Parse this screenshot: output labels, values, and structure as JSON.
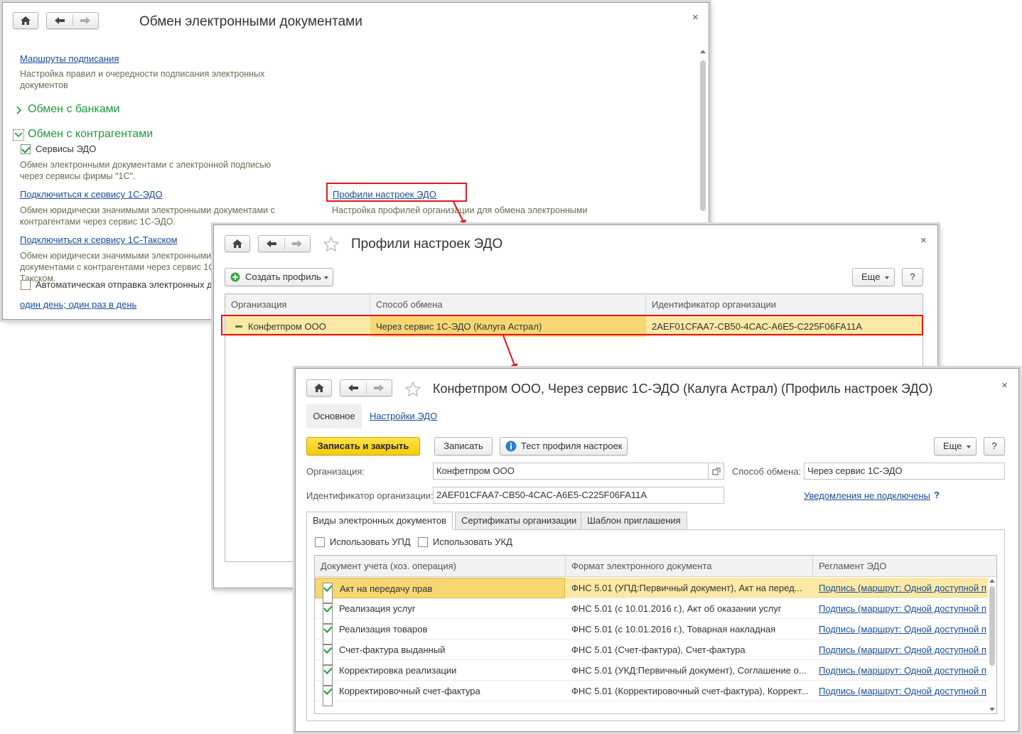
{
  "win1": {
    "title": "Обмен электронными документами",
    "close": "×",
    "routes_link": "Маршруты подписания",
    "routes_note": "Настройка правил и очередности подписания электронных документов",
    "banks_group": "Обмен с банками",
    "contractors_group": "Обмен с контрагентами",
    "edo_services_label": "Сервисы ЭДО",
    "edo_services_note": "Обмен электронными документами с электронной подписью через сервисы фирмы \"1С\".",
    "connect_1c_edo_link": "Подключиться к сервису 1С-ЭДО",
    "connect_1c_edo_note": "Обмен юридически значимыми электронными документами с контрагентами через сервис 1С-ЭДО.",
    "profiles_link": "Профили настроек ЭДО",
    "profiles_note": "Настройка профилей организации для обмена электронными",
    "connect_taxcom_link": "Подключиться к сервису 1С-Такском",
    "connect_taxcom_note": "Обмен юридически значимыми электронными документами с контрагентами через сервис 1С-Такском.",
    "auto_send_label": "Автоматическая отправка электронных до",
    "schedule_link": "один день; один раз в день"
  },
  "win2": {
    "title": "Профили настроек ЭДО",
    "close": "×",
    "create_button": "Создать профиль",
    "more_button": "Еще",
    "help_button": "?",
    "columns": [
      "Организация",
      "Способ обмена",
      "Идентификатор организации"
    ],
    "rows": [
      [
        "Конфетпром ООО",
        "Через сервис 1С-ЭДО (Калуга Астрал)",
        "2AEF01CFAA7-CB50-4CAC-A6E5-C225F06FA11A"
      ]
    ]
  },
  "win3": {
    "title": "Конфетпром ООО, Через сервис 1С-ЭДО (Калуга Астрал) (Профиль настроек ЭДО)",
    "close": "×",
    "tab_main": "Основное",
    "tab_settings_link": "Настройки ЭДО",
    "save_close_button": "Записать и закрыть",
    "save_button": "Записать",
    "test_button": "Тест профиля настроек",
    "more_button": "Еще",
    "help_button": "?",
    "org_label": "Организация:",
    "org_value": "Конфетпром ООО",
    "method_label": "Способ обмена:",
    "method_value": "Через сервис 1С-ЭДО",
    "id_label": "Идентификатор организации:",
    "id_value": "2AEF01CFAA7-CB50-4CAC-A6E5-C225F06FA11A",
    "notifications_link": "Уведомления не подключены",
    "notifications_help": "?",
    "tabs": [
      "Виды электронных документов",
      "Сертификаты организации",
      "Шаблон приглашения"
    ],
    "use_upd": "Использовать УПД",
    "use_ukd": "Использовать УКД",
    "columns": [
      "Документ учета (хоз. операция)",
      "Формат электронного документа",
      "Регламент ЭДО"
    ],
    "rows": [
      {
        "doc": "Акт на передачу прав",
        "format": "ФНС 5.01 (УПД:Первичный документ), Акт на перед...",
        "reg": "Подпись (маршрут: Одной доступной п"
      },
      {
        "doc": "Реализация услуг",
        "format": "ФНС 5.01 (с 10.01.2016 г.), Акт об оказании услуг",
        "reg": "Подпись (маршрут: Одной доступной п"
      },
      {
        "doc": "Реализация товаров",
        "format": "ФНС 5.01 (с 10.01.2016 г.), Товарная накладная",
        "reg": "Подпись (маршрут: Одной доступной п"
      },
      {
        "doc": "Счет-фактура выданный",
        "format": "ФНС 5.01 (Счет-фактура), Счет-фактура",
        "reg": "Подпись (маршрут: Одной доступной п"
      },
      {
        "doc": "Корректировка реализации",
        "format": "ФНС 5.01 (УКД:Первичный документ), Соглашение о...",
        "reg": "Подпись (маршрут: Одной доступной п"
      },
      {
        "doc": "Корректировочный счет-фактура",
        "format": "ФНС 5.01 (Корректировочный счет-фактура), Коррект...",
        "reg": "Подпись (маршрут: Одной доступной п"
      }
    ]
  },
  "colors": {
    "accent_green": "#1f9a3a",
    "link_blue": "#1a4b9a",
    "highlight_red": "#e8141b",
    "selection_yellow": "#fbe9a5",
    "button_yellow": "#f5cb07"
  }
}
